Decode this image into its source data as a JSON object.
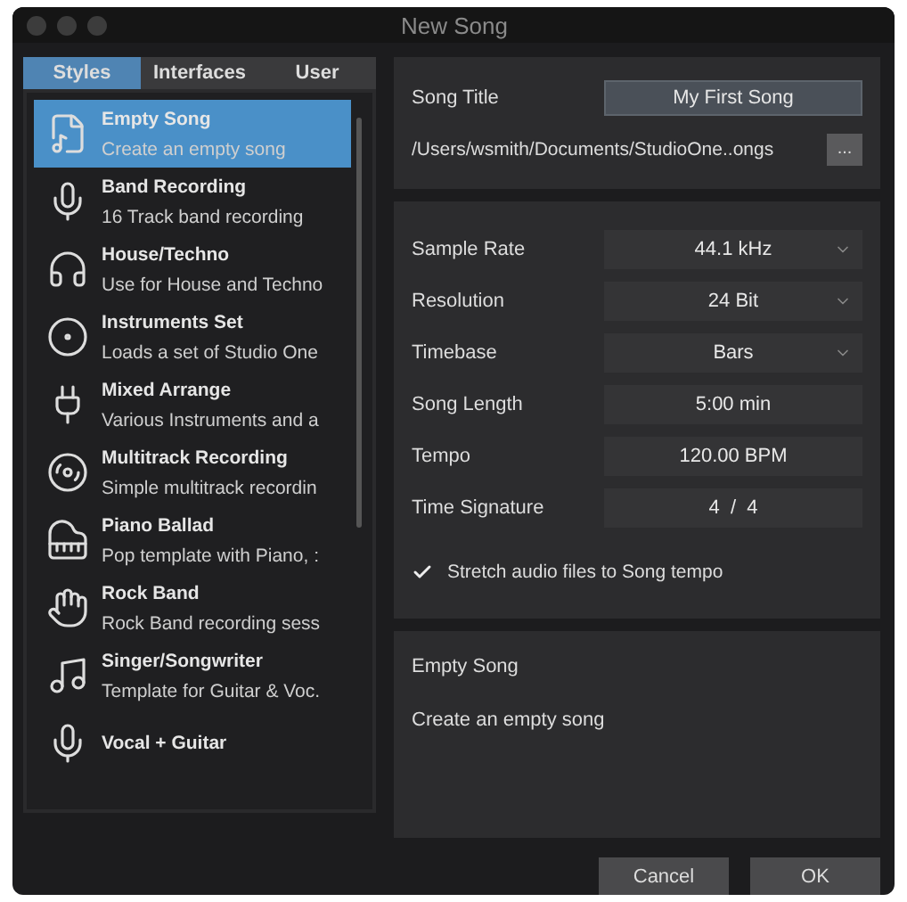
{
  "window": {
    "title": "New Song"
  },
  "tabs": [
    {
      "label": "Styles",
      "selected": true
    },
    {
      "label": "Interfaces",
      "selected": false
    },
    {
      "label": "User",
      "selected": false
    }
  ],
  "templates": [
    {
      "title": "Empty Song",
      "subtitle": "Create an empty song",
      "selected": true
    },
    {
      "title": "Band Recording",
      "subtitle": "16 Track band recording",
      "selected": false
    },
    {
      "title": "House/Techno",
      "subtitle": "Use for House and Techno",
      "selected": false
    },
    {
      "title": "Instruments Set",
      "subtitle": "Loads a set of  Studio One",
      "selected": false
    },
    {
      "title": "Mixed Arrange",
      "subtitle": "Various Instruments and a",
      "selected": false
    },
    {
      "title": "Multitrack Recording",
      "subtitle": "Simple multitrack recordin",
      "selected": false
    },
    {
      "title": "Piano Ballad",
      "subtitle": "Pop template with Piano, :",
      "selected": false
    },
    {
      "title": "Rock Band",
      "subtitle": "Rock Band recording sess",
      "selected": false
    },
    {
      "title": "Singer/Songwriter",
      "subtitle": "Template for Guitar & Voc.",
      "selected": false
    },
    {
      "title": "Vocal + Guitar",
      "selected": false
    }
  ],
  "song_title": {
    "label": "Song Title",
    "value": "My First Song"
  },
  "path": {
    "value": "/Users/wsmith/Documents/StudioOne..ongs",
    "browse": "..."
  },
  "settings": [
    {
      "label": "Sample Rate",
      "value": "44.1 kHz",
      "kind": "dropdown"
    },
    {
      "label": "Resolution",
      "value": "24 Bit",
      "kind": "dropdown"
    },
    {
      "label": "Timebase",
      "value": "Bars",
      "kind": "dropdown"
    },
    {
      "label": "Song Length",
      "value": "5:00 min",
      "kind": "field"
    },
    {
      "label": "Tempo",
      "value": "120.00 BPM",
      "kind": "field"
    },
    {
      "label": "Time Signature",
      "value": "4  /  4",
      "kind": "field"
    }
  ],
  "stretch": {
    "label": "Stretch audio files to Song tempo",
    "checked": true
  },
  "description": {
    "title": "Empty Song",
    "text": "Create an empty song"
  },
  "buttons": [
    {
      "label": "Cancel"
    },
    {
      "label": "OK"
    }
  ]
}
